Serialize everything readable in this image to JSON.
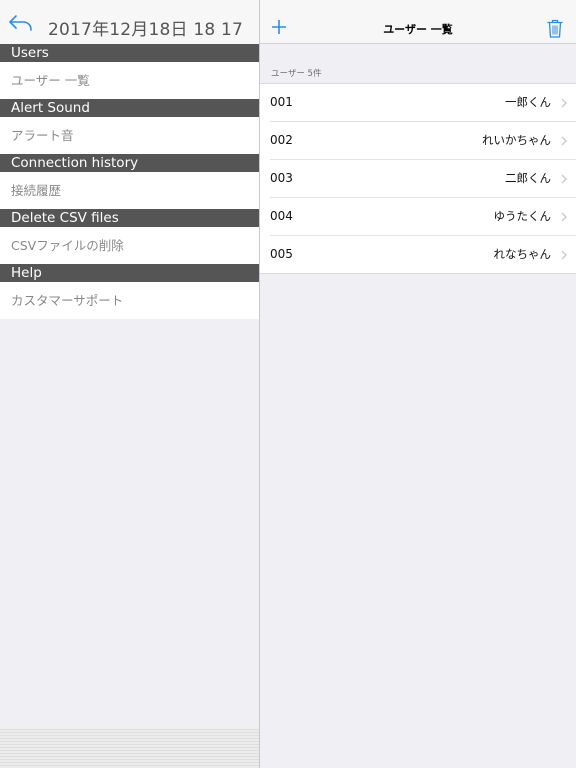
{
  "left_panel": {
    "datetime": "2017年12月18日 18 17",
    "sections": [
      {
        "header": "Users",
        "item": "ユーザー 一覧"
      },
      {
        "header": "Alert Sound",
        "item": "アラート音"
      },
      {
        "header": "Connection history",
        "item": "接続履歴"
      },
      {
        "header": "Delete CSV files",
        "item": "CSVファイルの削除"
      },
      {
        "header": "Help",
        "item": "カスタマーサポート"
      }
    ]
  },
  "right_panel": {
    "title": "ユーザー 一覧",
    "count_label": "ユーザー 5件",
    "users": [
      {
        "id": "001",
        "name": "一郎くん"
      },
      {
        "id": "002",
        "name": "れいかちゃん"
      },
      {
        "id": "003",
        "name": "二郎くん"
      },
      {
        "id": "004",
        "name": "ゆうたくん"
      },
      {
        "id": "005",
        "name": "れなちゃん"
      }
    ]
  },
  "icons": {
    "back": "reply-arrow-icon",
    "add": "plus-icon",
    "delete": "trash-icon",
    "disclosure": "chevron-right-icon"
  },
  "colors": {
    "accent": "#2d8ce6",
    "section_header_bg": "#555555",
    "panel_bg": "#efeff4"
  }
}
